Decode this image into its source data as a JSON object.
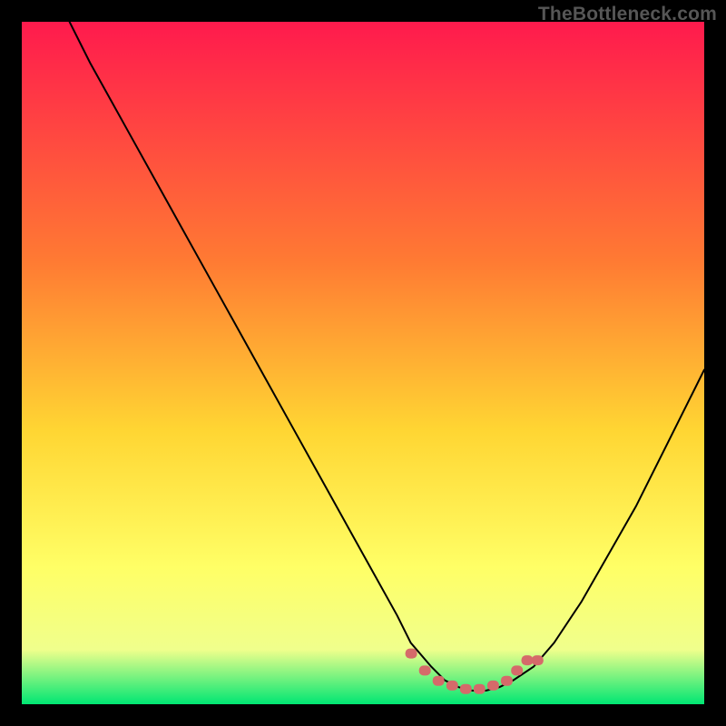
{
  "watermark": "TheBottleneck.com",
  "colors": {
    "black": "#000000",
    "curve": "#000000",
    "marker": "#d56a6a",
    "gradient_top": "#ff1a4d",
    "gradient_mid1": "#ff7a33",
    "gradient_mid2": "#ffd633",
    "gradient_mid3": "#ffff66",
    "gradient_mid4": "#f0ff8c",
    "gradient_bottom": "#00e673"
  },
  "chart_data": {
    "type": "line",
    "title": "",
    "xlabel": "",
    "ylabel": "",
    "x_range": [
      0,
      100
    ],
    "y_range": [
      0,
      100
    ],
    "series": [
      {
        "name": "bottleneck-curve",
        "x": [
          7,
          10,
          15,
          20,
          25,
          30,
          35,
          40,
          45,
          50,
          55,
          57,
          60,
          62,
          64,
          66,
          68,
          70,
          72,
          75,
          78,
          82,
          86,
          90,
          94,
          98,
          100
        ],
        "y": [
          100,
          94,
          85,
          76,
          67,
          58,
          49,
          40,
          31,
          22,
          13,
          9,
          5.5,
          3.5,
          2.5,
          2,
          2,
          2.5,
          3.5,
          5.5,
          9,
          15,
          22,
          29,
          37,
          45,
          49
        ]
      }
    ],
    "markers": {
      "name": "highlight-band",
      "x": [
        57,
        59,
        61,
        63,
        65,
        67,
        69,
        71,
        72.5,
        74,
        75.5
      ],
      "y": [
        7.5,
        5,
        3.5,
        2.8,
        2.3,
        2.3,
        2.8,
        3.5,
        5,
        6.5,
        6.5
      ]
    }
  }
}
